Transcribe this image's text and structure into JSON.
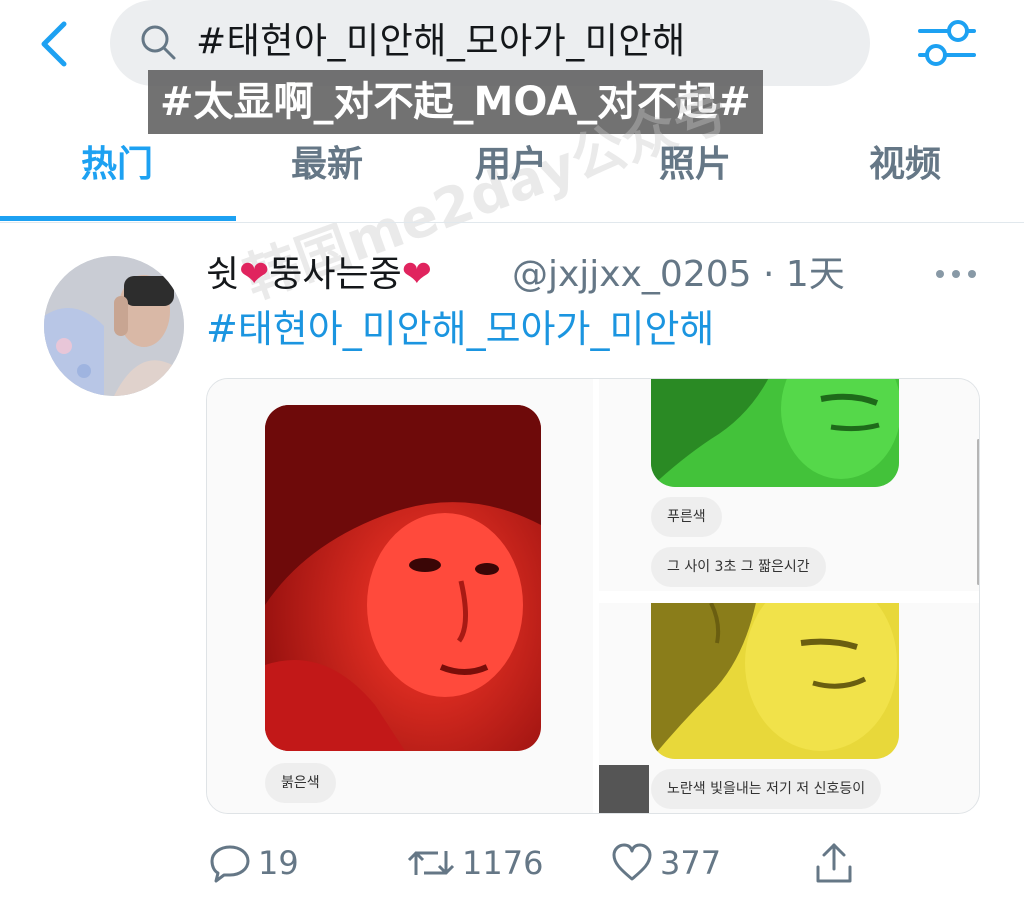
{
  "header": {
    "search_query": "#태현아_미안해_모아가_미안해",
    "caption": "#太显啊_对不起_MOA_对不起#",
    "watermark": "韩国me2day公众号"
  },
  "tabs": [
    {
      "label": "热门",
      "active": true
    },
    {
      "label": "最新",
      "active": false
    },
    {
      "label": "用户",
      "active": false
    },
    {
      "label": "照片",
      "active": false
    },
    {
      "label": "视频",
      "active": false
    }
  ],
  "tweet": {
    "display_name_before": "쉿",
    "display_name_middle": "뚱사는중",
    "handle": "@jxjjxx_0205 · 1天",
    "hashtag": "#태현아_미안해_모아가_미안해",
    "media": {
      "left_chip": "붉은색",
      "top_right_chip1": "푸른색",
      "top_right_chip2": "그 사이 3초 그 짧은시간",
      "bottom_right_chip": "노란색 빛을내는 저기 저 신호등이"
    },
    "actions": {
      "replies": "19",
      "retweets": "1176",
      "likes": "377"
    }
  },
  "colors": {
    "accent": "#1da1f2",
    "muted": "#657786",
    "heart": "#e0245e"
  }
}
